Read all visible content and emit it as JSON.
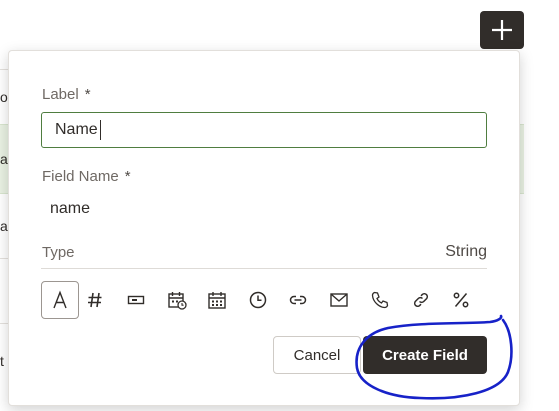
{
  "background": {
    "row_letters": [
      "o",
      "a",
      "a",
      "t"
    ]
  },
  "toolbar": {
    "add_icon": "plus-icon"
  },
  "form": {
    "label": {
      "label": "Label",
      "required_mark": "*",
      "value": "Name"
    },
    "field_name": {
      "label": "Field Name",
      "required_mark": "*",
      "value": "name"
    },
    "type": {
      "label": "Type",
      "selected_name": "String",
      "options": [
        {
          "icon": "string-icon",
          "selected": true
        },
        {
          "icon": "number-icon",
          "selected": false
        },
        {
          "icon": "boolean-icon",
          "selected": false
        },
        {
          "icon": "datetime-icon",
          "selected": false
        },
        {
          "icon": "date-icon",
          "selected": false
        },
        {
          "icon": "time-icon",
          "selected": false
        },
        {
          "icon": "url-icon",
          "selected": false
        },
        {
          "icon": "email-icon",
          "selected": false
        },
        {
          "icon": "phone-icon",
          "selected": false
        },
        {
          "icon": "reference-icon",
          "selected": false
        },
        {
          "icon": "percent-icon",
          "selected": false
        }
      ]
    },
    "actions": {
      "cancel_label": "Cancel",
      "create_label": "Create Field"
    }
  },
  "colors": {
    "primary_dark": "#312d2a",
    "input_border_focus": "#4f7d40",
    "annotation_ink": "#1722c8",
    "row_highlight": "#e9f2e3"
  }
}
